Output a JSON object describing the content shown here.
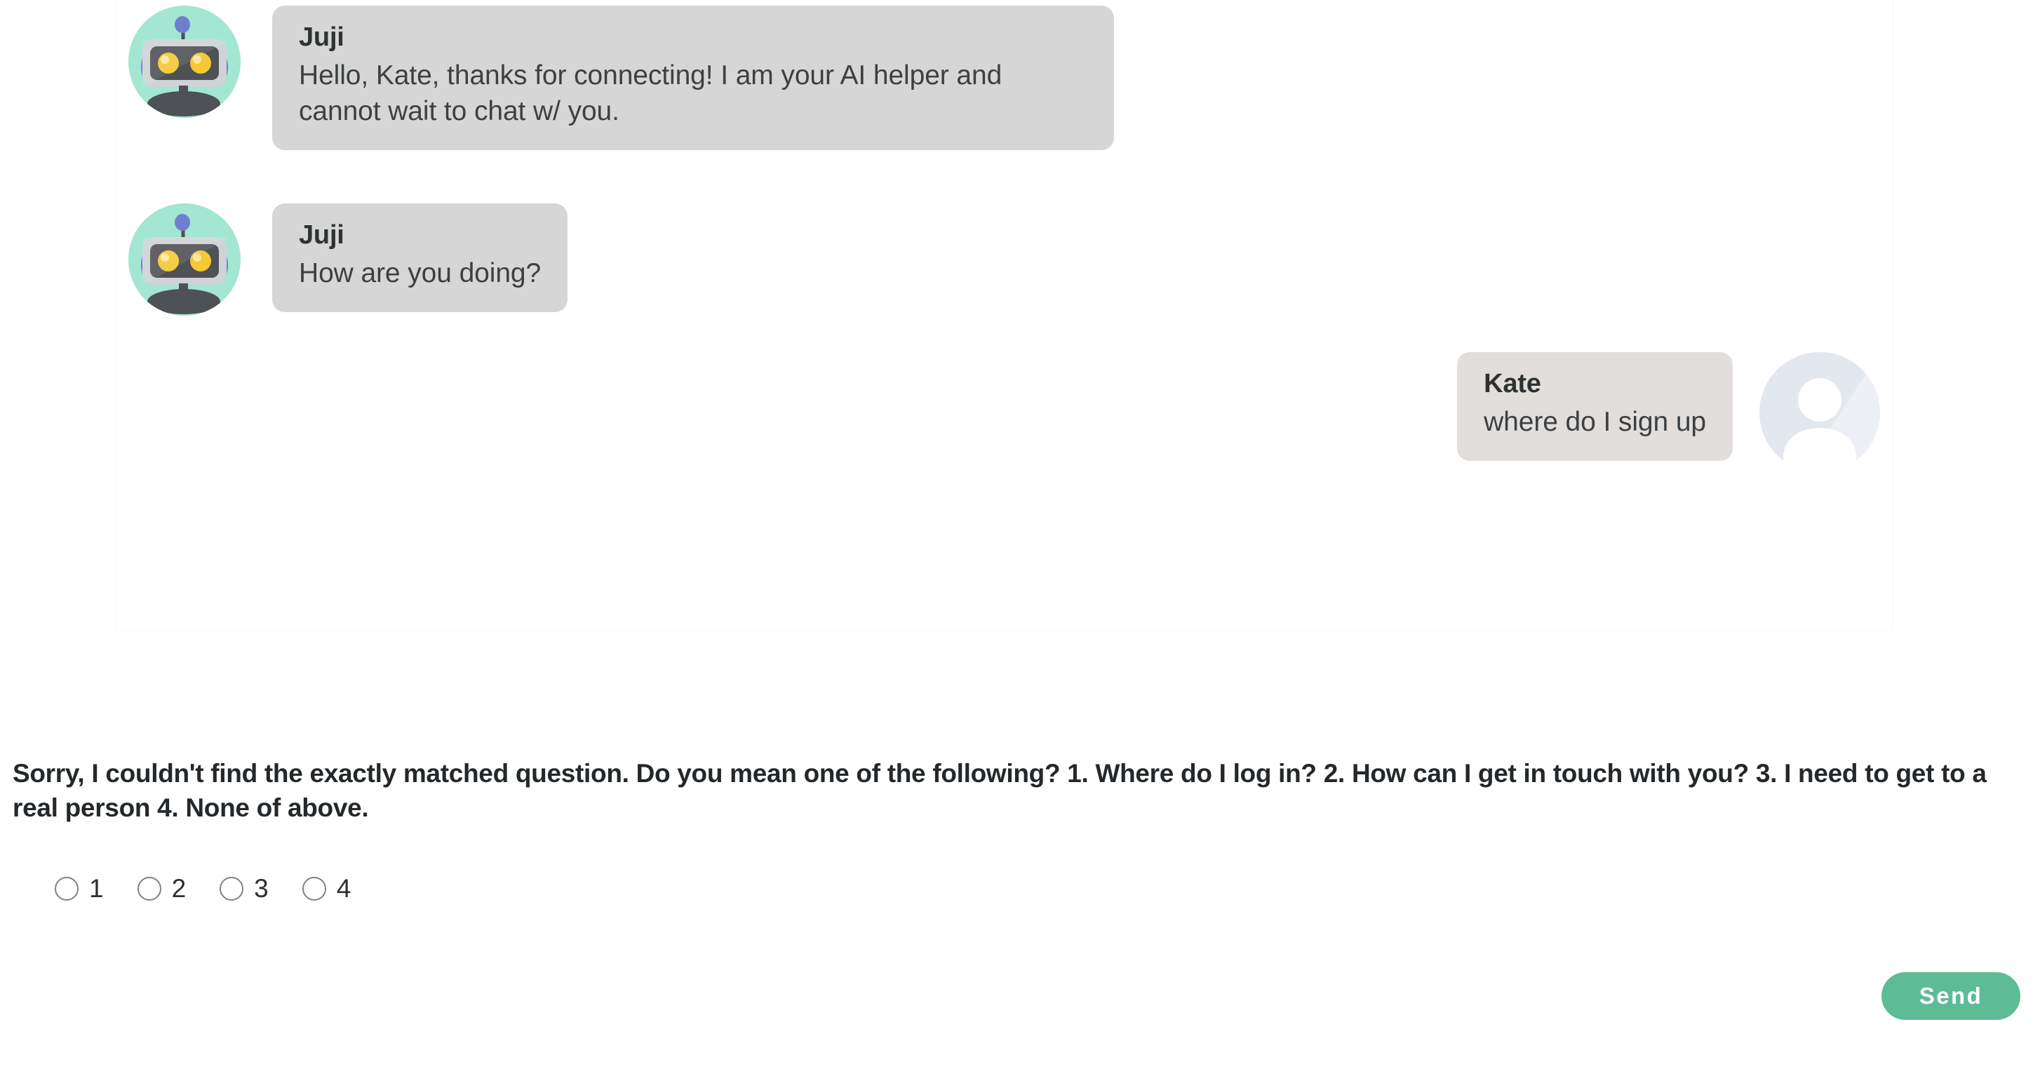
{
  "chat": {
    "messages": [
      {
        "sender": "Juji",
        "text": "Hello, Kate, thanks for connecting! I am your AI helper and cannot wait to chat w/ you.",
        "side": "left",
        "avatar_icon": "robot-avatar-icon"
      },
      {
        "sender": "Juji",
        "text": "How are you doing?",
        "side": "left",
        "avatar_icon": "robot-avatar-icon"
      },
      {
        "sender": "Kate",
        "text": "where do I sign up",
        "side": "right",
        "avatar_icon": "user-avatar-icon"
      }
    ]
  },
  "prompt": {
    "text": "Sorry, I couldn't find the exactly matched question. Do you mean one of the following? 1. Where do I log in? 2. How can I get in touch with you? 3. I need to get to a real person 4. None of above.",
    "options": [
      {
        "label": "1",
        "value": "1",
        "selected": false
      },
      {
        "label": "2",
        "value": "2",
        "selected": false
      },
      {
        "label": "3",
        "value": "3",
        "selected": false
      },
      {
        "label": "4",
        "value": "4",
        "selected": false
      }
    ]
  },
  "actions": {
    "send_label": "Send"
  },
  "colors": {
    "bot_bubble": "#d6d6d6",
    "user_bubble": "#e1dedc",
    "send_button": "#5dbc95",
    "bot_avatar_bg": "#a3e6d2",
    "user_avatar_bg": "#e3e7ee",
    "text_primary": "#3d4042",
    "text_heading": "#2f3233"
  }
}
